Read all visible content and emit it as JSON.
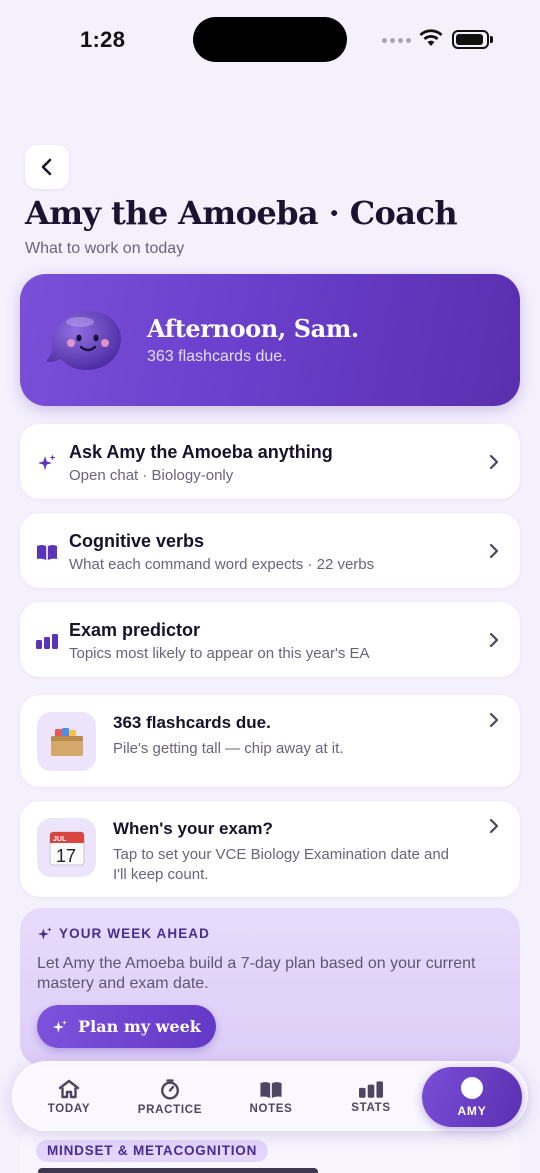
{
  "status_bar": {
    "time": "1:28"
  },
  "header": {
    "title": "Amy the Amoeba · Coach",
    "subtitle": "What to work on today"
  },
  "hero": {
    "greeting": "Afternoon, Sam.",
    "due_text": "363 flashcards due."
  },
  "menu_cards": [
    {
      "title": "Ask Amy the Amoeba anything",
      "desc": "Open chat · Biology-only",
      "icon": "sparkle-icon"
    },
    {
      "title": "Cognitive verbs",
      "desc": "What each command word expects · 22 verbs",
      "icon": "book-icon"
    },
    {
      "title": "Exam predictor",
      "desc": "Topics most likely to appear on this year's EA",
      "icon": "bar-chart-icon"
    }
  ],
  "flashcards_card": {
    "title": "363 flashcards due.",
    "desc": "Pile's getting tall — chip away at it.",
    "icon": "card-box-icon"
  },
  "exam_card": {
    "title": "When's your exam?",
    "desc": "Tap to set your VCE Biology Examination date and I'll keep count.",
    "calendar_month": "JUL",
    "calendar_day": "17",
    "icon": "calendar-icon"
  },
  "week_ahead": {
    "label": "YOUR WEEK AHEAD",
    "desc": "Let Amy the Amoeba build a 7-day plan based on your current mastery and exam date.",
    "button_label": "Plan my week"
  },
  "mindset": {
    "label": "MINDSET & METACOGNITION"
  },
  "tabbar": {
    "tabs": [
      {
        "label": "TODAY",
        "icon": "home-icon"
      },
      {
        "label": "PRACTICE",
        "icon": "timer-icon"
      },
      {
        "label": "NOTES",
        "icon": "book-icon"
      },
      {
        "label": "STATS",
        "icon": "bar-chart-icon"
      },
      {
        "label": "AMY",
        "icon": "amy-avatar-icon",
        "active": true
      }
    ]
  },
  "colors": {
    "accent": "#6a3fcc",
    "accent_dark": "#4a2b94",
    "background": "#f4f0fc",
    "card": "#ffffff"
  }
}
